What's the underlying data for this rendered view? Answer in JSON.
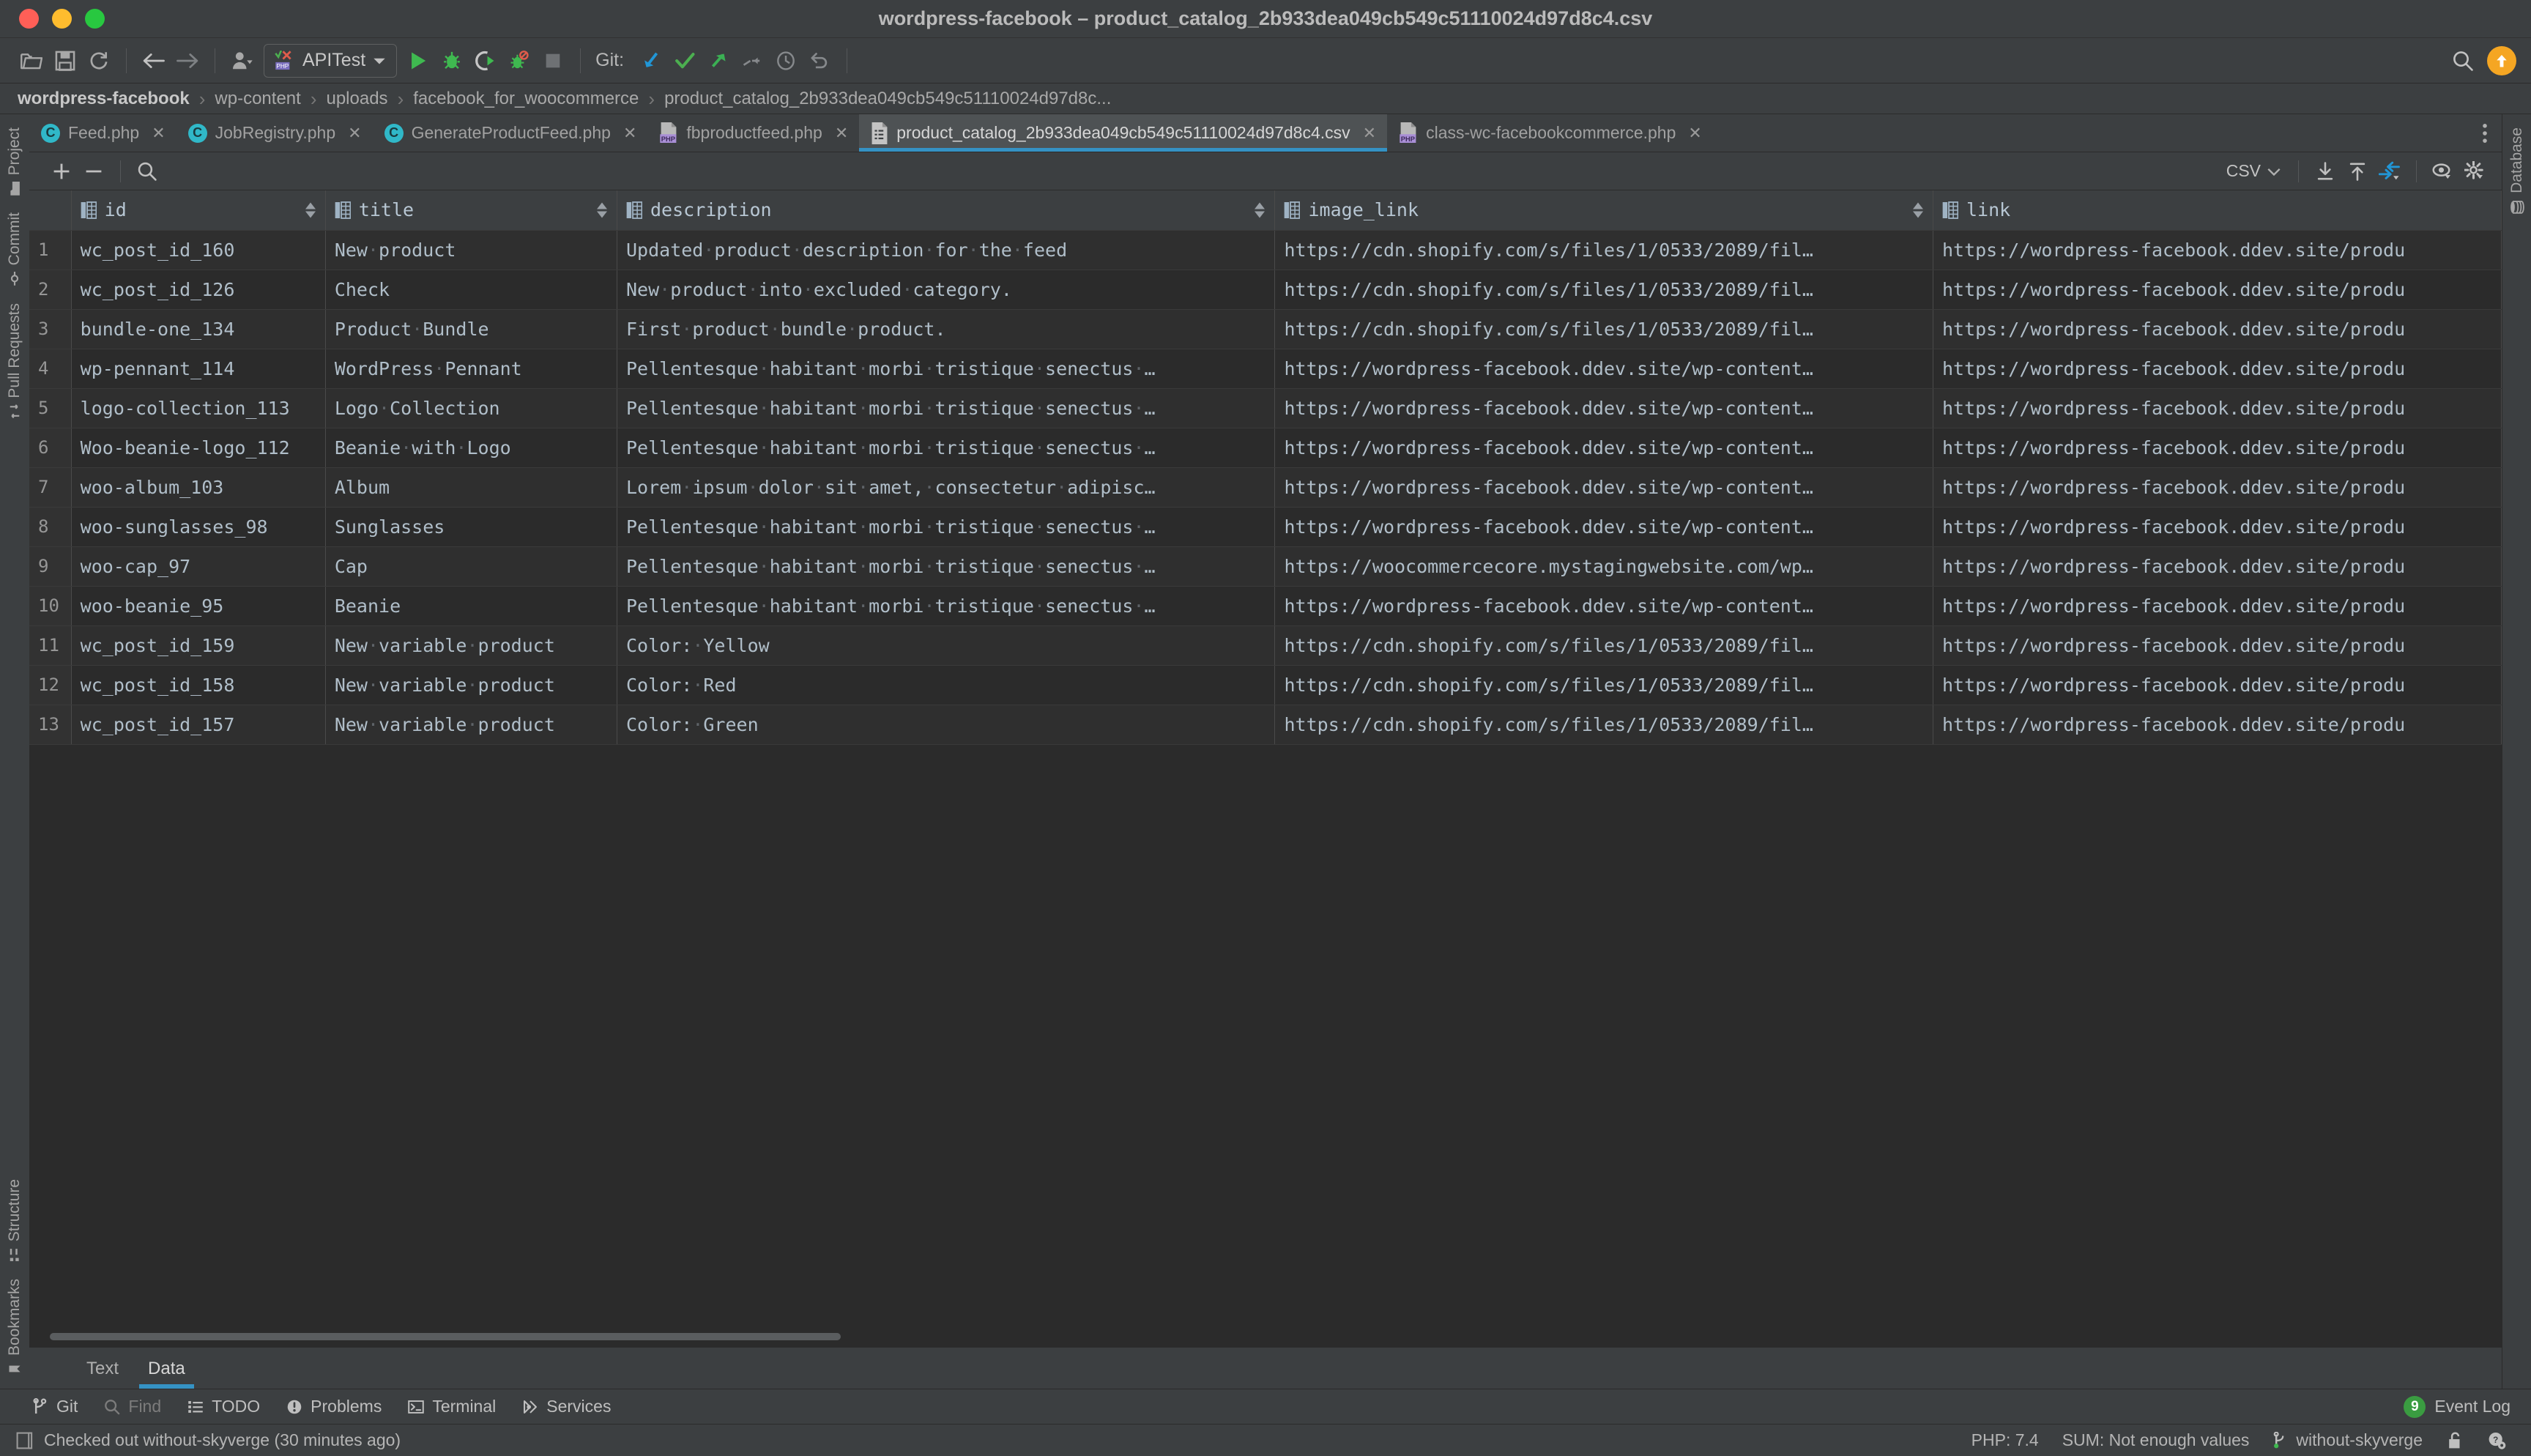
{
  "window": {
    "title": "wordpress-facebook – product_catalog_2b933dea049cb549c51110024d97d8c4.csv",
    "traffic_lights": [
      "close",
      "minimize",
      "maximize"
    ]
  },
  "toolbar": {
    "open_label": "open-folder-icon",
    "save_label": "save-icon",
    "sync_label": "sync-icon",
    "back_label": "back-arrow-icon",
    "forward_label": "forward-arrow-icon",
    "profiler_label": "profiler-icon",
    "run_config": "APITest",
    "run_label": "run-icon",
    "debug_label": "debug-icon",
    "run_coverage_label": "run-with-coverage-icon",
    "debug_stop_label": "stop-debug-icon",
    "stop_label": "stop-icon",
    "git_label": "Git:",
    "git_update": "update-project-icon",
    "git_commit": "commit-icon",
    "git_push": "push-icon",
    "git_merge": "merge-icon",
    "git_history": "history-icon",
    "git_rollback": "rollback-icon",
    "search_label": "search-everywhere-icon",
    "updates_label": "updates-available-icon"
  },
  "breadcrumb": {
    "items": [
      "wordpress-facebook",
      "wp-content",
      "uploads",
      "facebook_for_woocommerce",
      "product_catalog_2b933dea049cb549c51110024d97d8c..."
    ],
    "separator": "›"
  },
  "editor_tabs": {
    "items": [
      {
        "label": "Feed.php",
        "icon": "php-class-icon",
        "active": false,
        "closeable": true
      },
      {
        "label": "JobRegistry.php",
        "icon": "php-class-icon",
        "active": false,
        "closeable": true
      },
      {
        "label": "GenerateProductFeed.php",
        "icon": "php-class-icon",
        "active": false,
        "closeable": true
      },
      {
        "label": "fbproductfeed.php",
        "icon": "php-file-icon",
        "active": false,
        "closeable": true
      },
      {
        "label": "product_catalog_2b933dea049cb549c51110024d97d8c4.csv",
        "icon": "csv-file-icon",
        "active": true,
        "closeable": true
      },
      {
        "label": "class-wc-facebookcommerce.php",
        "icon": "php-file-icon",
        "active": false,
        "closeable": true
      }
    ],
    "overflow_label": "more-tabs-icon"
  },
  "data_toolbar": {
    "add_label": "add-row-icon",
    "remove_label": "remove-row-icon",
    "search_label": "search-icon",
    "format": "CSV",
    "import_label": "import-data-icon",
    "export_label": "export-data-icon",
    "transpose_label": "transpose-icon",
    "view_label": "view-options-icon",
    "settings_label": "settings-icon"
  },
  "left_stripe": {
    "top": [
      {
        "label": "Project",
        "icon": "project-icon"
      },
      {
        "label": "Commit",
        "icon": "commit-icon"
      },
      {
        "label": "Pull Requests",
        "icon": "pull-requests-icon"
      }
    ],
    "bottom": [
      {
        "label": "Structure",
        "icon": "structure-icon"
      },
      {
        "label": "Bookmarks",
        "icon": "bookmarks-icon"
      }
    ]
  },
  "right_stripe": {
    "top": [
      {
        "label": "Database",
        "icon": "database-icon"
      }
    ]
  },
  "table": {
    "columns": [
      {
        "key": "id",
        "label": "id"
      },
      {
        "key": "title",
        "label": "title"
      },
      {
        "key": "description",
        "label": "description"
      },
      {
        "key": "image_link",
        "label": "image_link"
      },
      {
        "key": "link",
        "label": "link"
      }
    ],
    "rows": [
      {
        "n": "1",
        "id": "wc_post_id_160",
        "title": "New product",
        "description": "Updated product description for the feed",
        "image_link": "https://cdn.shopify.com/s/files/1/0533/2089/fil…",
        "link": "https://wordpress-facebook.ddev.site/produ"
      },
      {
        "n": "2",
        "id": "wc_post_id_126",
        "title": "Check",
        "description": "New product into excluded category.",
        "image_link": "https://cdn.shopify.com/s/files/1/0533/2089/fil…",
        "link": "https://wordpress-facebook.ddev.site/produ"
      },
      {
        "n": "3",
        "id": "bundle-one_134",
        "title": "Product Bundle",
        "description": "First product bundle product.",
        "image_link": "https://cdn.shopify.com/s/files/1/0533/2089/fil…",
        "link": "https://wordpress-facebook.ddev.site/produ"
      },
      {
        "n": "4",
        "id": "wp-pennant_114",
        "title": "WordPress Pennant",
        "description": "Pellentesque habitant morbi tristique senectus …",
        "image_link": "https://wordpress-facebook.ddev.site/wp-content…",
        "link": "https://wordpress-facebook.ddev.site/produ"
      },
      {
        "n": "5",
        "id": "logo-collection_113",
        "title": "Logo Collection",
        "description": "Pellentesque habitant morbi tristique senectus …",
        "image_link": "https://wordpress-facebook.ddev.site/wp-content…",
        "link": "https://wordpress-facebook.ddev.site/produ"
      },
      {
        "n": "6",
        "id": "Woo-beanie-logo_112",
        "title": "Beanie with Logo",
        "description": "Pellentesque habitant morbi tristique senectus …",
        "image_link": "https://wordpress-facebook.ddev.site/wp-content…",
        "link": "https://wordpress-facebook.ddev.site/produ"
      },
      {
        "n": "7",
        "id": "woo-album_103",
        "title": "Album",
        "description": "Lorem ipsum dolor sit amet, consectetur adipisc…",
        "image_link": "https://wordpress-facebook.ddev.site/wp-content…",
        "link": "https://wordpress-facebook.ddev.site/produ"
      },
      {
        "n": "8",
        "id": "woo-sunglasses_98",
        "title": "Sunglasses",
        "description": "Pellentesque habitant morbi tristique senectus …",
        "image_link": "https://wordpress-facebook.ddev.site/wp-content…",
        "link": "https://wordpress-facebook.ddev.site/produ"
      },
      {
        "n": "9",
        "id": "woo-cap_97",
        "title": "Cap",
        "description": "Pellentesque habitant morbi tristique senectus …",
        "image_link": "https://woocommercecore.mystagingwebsite.com/wp…",
        "link": "https://wordpress-facebook.ddev.site/produ"
      },
      {
        "n": "10",
        "id": "woo-beanie_95",
        "title": "Beanie",
        "description": "Pellentesque habitant morbi tristique senectus …",
        "image_link": "https://wordpress-facebook.ddev.site/wp-content…",
        "link": "https://wordpress-facebook.ddev.site/produ"
      },
      {
        "n": "11",
        "id": "wc_post_id_159",
        "title": "New variable product",
        "description": "Color: Yellow",
        "image_link": "https://cdn.shopify.com/s/files/1/0533/2089/fil…",
        "link": "https://wordpress-facebook.ddev.site/produ"
      },
      {
        "n": "12",
        "id": "wc_post_id_158",
        "title": "New variable product",
        "description": "Color: Red",
        "image_link": "https://cdn.shopify.com/s/files/1/0533/2089/fil…",
        "link": "https://wordpress-facebook.ddev.site/produ"
      },
      {
        "n": "13",
        "id": "wc_post_id_157",
        "title": "New variable product",
        "description": "Color: Green",
        "image_link": "https://cdn.shopify.com/s/files/1/0533/2089/fil…",
        "link": "https://wordpress-facebook.ddev.site/produ"
      }
    ]
  },
  "editor_view_tabs": {
    "items": [
      {
        "label": "Text",
        "active": false
      },
      {
        "label": "Data",
        "active": true
      }
    ]
  },
  "toolwindow_bar": {
    "items": [
      {
        "label": "Git",
        "icon": "git-branch-icon",
        "dim": false
      },
      {
        "label": "Find",
        "icon": "search-icon",
        "dim": true
      },
      {
        "label": "TODO",
        "icon": "todo-list-icon",
        "dim": false
      },
      {
        "label": "Problems",
        "icon": "problems-icon",
        "dim": false
      },
      {
        "label": "Terminal",
        "icon": "terminal-icon",
        "dim": false
      },
      {
        "label": "Services",
        "icon": "services-icon",
        "dim": false
      }
    ],
    "event_log": {
      "label": "Event Log",
      "count": "9",
      "icon": "event-log-icon"
    }
  },
  "status_bar": {
    "message": "Checked out without-skyverge (30 minutes ago)",
    "message_icon": "notification-icon",
    "php_version": "PHP: 7.4",
    "sum": "SUM: Not enough values",
    "branch": "without-skyverge",
    "branch_icon": "git-branch-icon",
    "lock_icon": "unlocked-icon",
    "help_icon": "help-icon"
  },
  "colors": {
    "accent_blue": "#3592c4",
    "chrome": "#3c3f41",
    "grid_bg": "#2b2b2b",
    "green": "#3a9c41",
    "orange": "#f5a623"
  }
}
